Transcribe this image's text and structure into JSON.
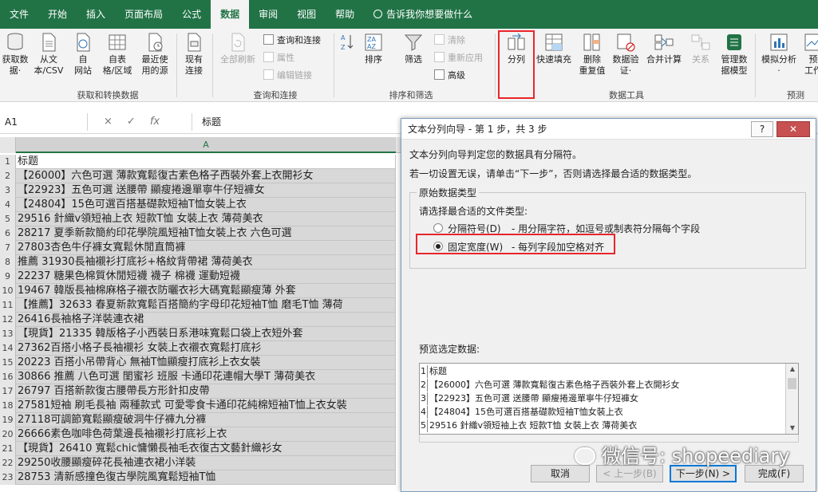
{
  "tabs": [
    "文件",
    "开始",
    "插入",
    "页面布局",
    "公式",
    "数据",
    "审阅",
    "视图",
    "帮助",
    "告诉我你想要做什么"
  ],
  "active_tab": "数据",
  "ribbon": {
    "get_transform": {
      "buttons": [
        "获取数\n据·",
        "从文\n本/CSV",
        "自\n网站",
        "自表\n格/区域",
        "最近使\n用的源"
      ],
      "label": "获取和转换数据"
    },
    "existing": "现有\n连接",
    "query": {
      "refresh_all": "全部刷新",
      "items": [
        "查询和连接",
        "属性",
        "编辑链接"
      ],
      "label": "查询和连接"
    },
    "sort_filter": {
      "sort": "排序",
      "filter": "筛选",
      "items": [
        "清除",
        "重新应用",
        "高级"
      ],
      "label": "排序和筛选"
    },
    "data_tools": {
      "buttons": [
        "分列",
        "快速填充",
        "删除\n重复值",
        "数据验\n证·",
        "合并计算",
        "关系",
        "管理数\n据模型"
      ],
      "label": "数据工具"
    },
    "forecast": {
      "buttons": [
        "模拟分析\n·",
        "预\n工作"
      ],
      "label": "预测"
    }
  },
  "formula_bar": {
    "name_box": "A1",
    "icons": [
      "×",
      "✓",
      "fx"
    ],
    "content": "标题"
  },
  "grid": {
    "column": "A",
    "rows": [
      {
        "n": "1",
        "v": "标题"
      },
      {
        "n": "2",
        "v": "【26000】六色可選 薄款寬鬆復古素色格子西裝外套上衣開衫女"
      },
      {
        "n": "3",
        "v": "【22923】五色可選 送腰帶 顯瘦捲邊單寧牛仔短褲女"
      },
      {
        "n": "4",
        "v": "【24804】15色可選百搭基礎款短袖T恤女裝上衣"
      },
      {
        "n": "5",
        "v": "29516 針織v領短袖上衣 短款T恤 女裝上衣 薄荷美衣"
      },
      {
        "n": "6",
        "v": "28217 夏季新款簡約印花學院風短袖T恤女裝上衣 六色可選"
      },
      {
        "n": "7",
        "v": "27803杏色牛仔褲女寬鬆休閒直筒褲"
      },
      {
        "n": "8",
        "v": "推薦 31930長袖襯衫打底衫+格紋背帶裙 薄荷美衣"
      },
      {
        "n": "9",
        "v": "22237 糖果色棉質休閒短襪 襪子 棉襪 運動短襪"
      },
      {
        "n": "10",
        "v": "19467 韓版長袖棉麻格子襯衣防曬衣衫大碼寬鬆顯瘦薄 外套"
      },
      {
        "n": "11",
        "v": "【推薦】32633 春夏新款寬鬆百搭簡約字母印花短袖T恤 磨毛T恤 薄荷"
      },
      {
        "n": "12",
        "v": "26416長袖格子洋裝連衣裙"
      },
      {
        "n": "13",
        "v": "【現貨】21335 韓版格子小西裝日系港味寬鬆口袋上衣短外套"
      },
      {
        "n": "14",
        "v": "27362百搭小格子長袖襯衫 女裝上衣襯衣寬鬆打底衫"
      },
      {
        "n": "15",
        "v": "20223 百搭小吊帶背心 無袖T恤顯瘦打底衫上衣女裝"
      },
      {
        "n": "16",
        "v": "30866 推薦 八色可選 閨蜜衫 班服 卡通印花連帽大學T 薄荷美衣"
      },
      {
        "n": "17",
        "v": "26797 百搭新款復古腰帶長方形針扣皮帶"
      },
      {
        "n": "18",
        "v": "27581短袖  刷毛長袖 兩種款式 可愛零食卡通印花純棉短袖T恤上衣女裝"
      },
      {
        "n": "19",
        "v": "27118可調節寬鬆顯瘦破洞牛仔褲九分褲"
      },
      {
        "n": "20",
        "v": "26666素色咖啡色荷葉邊長袖襯衫打底衫上衣"
      },
      {
        "n": "21",
        "v": "【現貨】26410  寬鬆chic慵懶長袖毛衣復古文藝針織衫女"
      },
      {
        "n": "22",
        "v": "29250收腰顯瘦碎花長袖連衣裙小洋裝"
      },
      {
        "n": "23",
        "v": "28753  清新感撞色復古學院風寬鬆短袖T恤"
      }
    ]
  },
  "dialog": {
    "title": "文本分列向导 - 第 1 步，共 3 步",
    "help": "?",
    "close": "✕",
    "line1": "文本分列向导判定您的数据具有分隔符。",
    "line2": "若一切设置无误，请单击“下一步”，否则请选择最合适的数据类型。",
    "group_title": "原始数据类型",
    "prompt": "请选择最合适的文件类型:",
    "opt1": "分隔符号(D)",
    "opt1_desc": "- 用分隔字符，如逗号或制表符分隔每个字段",
    "opt2": "固定宽度(W)",
    "opt2_desc": "- 每列字段加空格对齐",
    "selected": "固定宽度(W)",
    "preview_label": "预览选定数据:",
    "preview": [
      {
        "n": "1",
        "v": "标题"
      },
      {
        "n": "2",
        "v": "【26000】六色可選 薄款寬鬆復古素色格子西裝外套上衣開衫女"
      },
      {
        "n": "3",
        "v": "【22923】五色可選 送腰帶 顯瘦捲邊單寧牛仔短褲女"
      },
      {
        "n": "4",
        "v": "【24804】15色可選百搭基礎款短袖T恤女裝上衣"
      },
      {
        "n": "5",
        "v": "29516 針織v領短袖上衣 短款T恤 女裝上衣 薄荷美衣"
      }
    ],
    "buttons": {
      "cancel": "取消",
      "back": "< 上一步(B)",
      "next": "下一步(N) >",
      "finish": "完成(F)"
    }
  },
  "watermark": "微信号: shopeediary",
  "colors": {
    "excel_green": "#217346",
    "highlight_red": "#e8262b"
  }
}
